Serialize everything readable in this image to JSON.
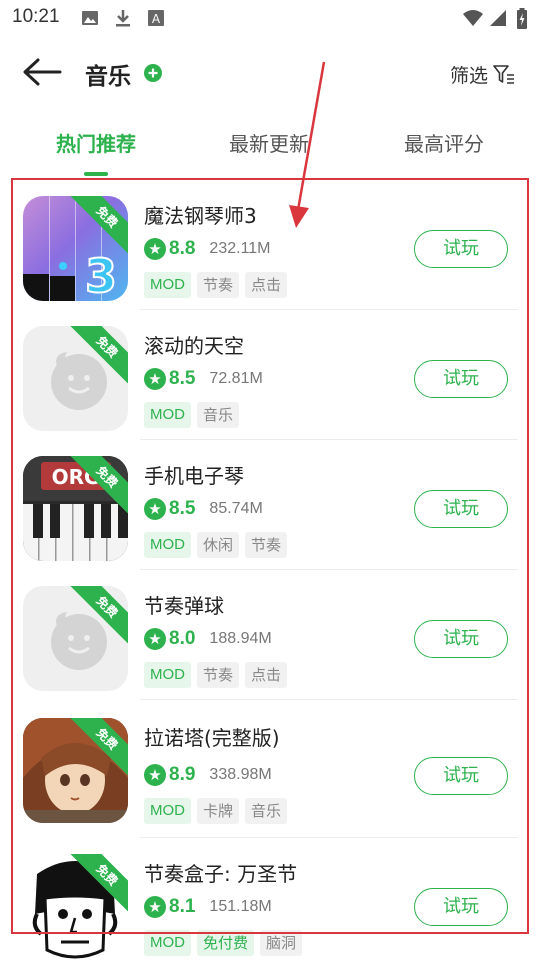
{
  "status_bar": {
    "time": "10:21"
  },
  "header": {
    "title": "音乐",
    "filter_label": "筛选"
  },
  "tabs": [
    {
      "label": "热门推荐",
      "active": true
    },
    {
      "label": "最新更新",
      "active": false
    },
    {
      "label": "最高评分",
      "active": false
    }
  ],
  "accent_color": "#2eb24e",
  "highlight_color": "#d9363e",
  "apps": [
    {
      "name": "魔法钢琴师3",
      "score": "8.8",
      "size": "232.11M",
      "tags": [
        "MOD",
        "节奏",
        "点击"
      ],
      "badge": "免费",
      "play": "试玩",
      "icon": "piano-tiles-icon"
    },
    {
      "name": "滚动的天空",
      "score": "8.5",
      "size": "72.81M",
      "tags": [
        "MOD",
        "音乐"
      ],
      "badge": "免费",
      "play": "试玩",
      "icon": "placeholder-app-icon"
    },
    {
      "name": "手机电子琴",
      "score": "8.5",
      "size": "85.74M",
      "tags": [
        "MOD",
        "休闲",
        "节奏"
      ],
      "badge": "免费",
      "play": "试玩",
      "icon": "org-keyboard-icon"
    },
    {
      "name": "节奏弹球",
      "score": "8.0",
      "size": "188.94M",
      "tags": [
        "MOD",
        "节奏",
        "点击"
      ],
      "badge": "免费",
      "play": "试玩",
      "icon": "placeholder-app-icon"
    },
    {
      "name": "拉诺塔(完整版)",
      "score": "8.9",
      "size": "338.98M",
      "tags": [
        "MOD",
        "卡牌",
        "音乐"
      ],
      "badge": "免费",
      "play": "试玩",
      "icon": "lanota-girl-icon"
    },
    {
      "name": "节奏盒子: 万圣节",
      "score": "8.1",
      "size": "151.18M",
      "tags": [
        "MOD",
        "免付费",
        "脑洞"
      ],
      "badge": "免费",
      "play": "试玩",
      "icon": "incredibox-face-icon"
    }
  ]
}
